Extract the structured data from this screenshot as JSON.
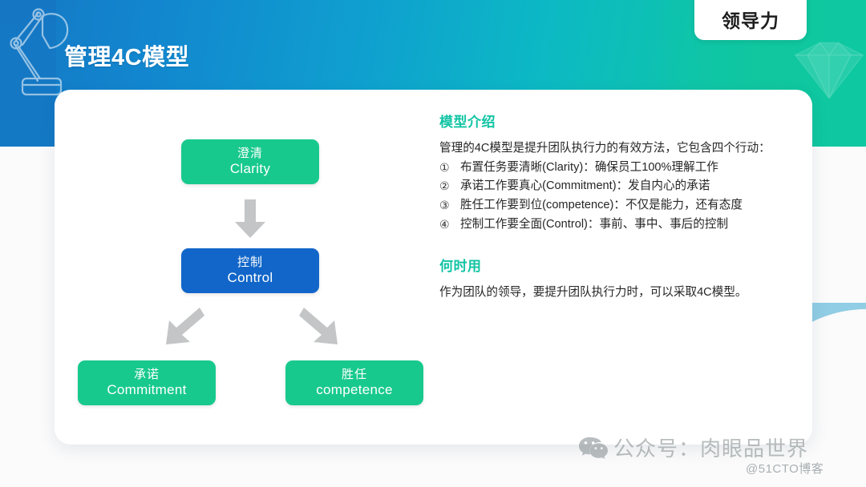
{
  "slide": {
    "title": "管理4C模型",
    "category_badge": "领导力"
  },
  "diagram": {
    "boxes": [
      {
        "cn": "澄清",
        "en": "Clarity",
        "color": "#18c98e"
      },
      {
        "cn": "控制",
        "en": "Control",
        "color": "#1266c9"
      },
      {
        "cn": "承诺",
        "en": "Commitment",
        "color": "#18c98e"
      },
      {
        "cn": "胜任",
        "en": "competence",
        "color": "#18c98e"
      }
    ],
    "arrow_color": "#c3c5c6"
  },
  "content": {
    "intro_heading": "模型介绍",
    "intro_paragraph": "管理的4C模型是提升团队执行力的有效方法，它包含四个行动：",
    "items": [
      {
        "marker": "①",
        "text": "布置任务要清晰(Clarity)：确保员工100%理解工作"
      },
      {
        "marker": "②",
        "text": "承诺工作要真心(Commitment)：发自内心的承诺"
      },
      {
        "marker": "③",
        "text": "胜任工作要到位(competence)：不仅是能力，还有态度"
      },
      {
        "marker": "④",
        "text": "控制工作要全面(Control)：事前、事中、事后的控制"
      }
    ],
    "when_heading": "何时用",
    "when_paragraph": "作为团队的领导，要提升团队执行力时，可以采取4C模型。"
  },
  "watermark": {
    "wechat_text": "公众号：肉眼品世界",
    "credit": "@51CTO博客"
  },
  "theme": {
    "header_blue": "#1577c4",
    "header_teal": "#10c79f",
    "accent_heading": "#12c4a4",
    "box_green": "#18c98e",
    "box_blue": "#1266c9",
    "arrow_gray": "#c3c5c6"
  }
}
